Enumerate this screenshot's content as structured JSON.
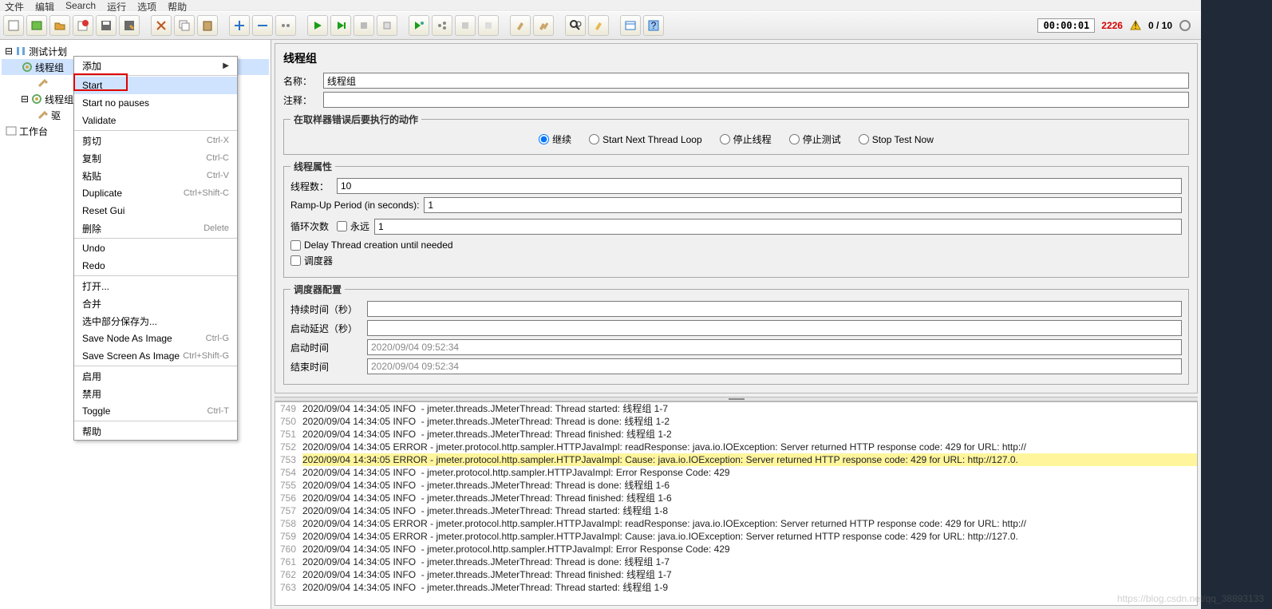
{
  "menubar": [
    "文件",
    "编辑",
    "Search",
    "运行",
    "选项",
    "帮助"
  ],
  "toolbar": {
    "timer": "00:00:01",
    "warn_count": "2226",
    "active": "0 / 10"
  },
  "tree": {
    "root": "测试计划",
    "items": [
      "线程组",
      "线程组",
      "驱"
    ],
    "workbench": "工作台"
  },
  "context_menu": {
    "add": "添加",
    "start": "Start",
    "start_np": "Start no pauses",
    "validate": "Validate",
    "cut": "剪切",
    "cut_sc": "Ctrl-X",
    "copy": "复制",
    "copy_sc": "Ctrl-C",
    "paste": "粘贴",
    "paste_sc": "Ctrl-V",
    "dup": "Duplicate",
    "dup_sc": "Ctrl+Shift-C",
    "reset": "Reset Gui",
    "del": "删除",
    "del_sc": "Delete",
    "undo": "Undo",
    "redo": "Redo",
    "open": "打开...",
    "merge": "合并",
    "save_sel": "选中部分保存为...",
    "save_img": "Save Node As Image",
    "save_img_sc": "Ctrl-G",
    "save_scr": "Save Screen As Image",
    "save_scr_sc": "Ctrl+Shift-G",
    "enable": "启用",
    "disable": "禁用",
    "toggle": "Toggle",
    "toggle_sc": "Ctrl-T",
    "help": "帮助"
  },
  "panel": {
    "title": "线程组",
    "name_label": "名称：",
    "name_value": "线程组",
    "comment_label": "注释：",
    "comment_value": "",
    "error_legend": "在取样器错误后要执行的动作",
    "r1": "继续",
    "r2": "Start Next Thread Loop",
    "r3": "停止线程",
    "r4": "停止测试",
    "r5": "Stop Test Now",
    "props_legend": "线程属性",
    "threads_label": "线程数：",
    "threads_value": "10",
    "ramp_label": "Ramp-Up Period (in seconds):",
    "ramp_value": "1",
    "loop_label": "循环次数",
    "forever_label": "永远",
    "loop_value": "1",
    "delay_cb": "Delay Thread creation until needed",
    "sched_cb": "调度器",
    "sched_legend": "调度器配置",
    "dur_label": "持续时间（秒）",
    "dur_value": "",
    "delay_label": "启动延迟（秒）",
    "delay_value": "",
    "start_label": "启动时间",
    "start_value": "2020/09/04 09:52:34",
    "end_label": "结束时间",
    "end_value": "2020/09/04 09:52:34"
  },
  "log": [
    {
      "n": 749,
      "t": "2020/09/04 14:34:05 INFO  - jmeter.threads.JMeterThread: Thread started: 线程组 1-7"
    },
    {
      "n": 750,
      "t": "2020/09/04 14:34:05 INFO  - jmeter.threads.JMeterThread: Thread is done: 线程组 1-2"
    },
    {
      "n": 751,
      "t": "2020/09/04 14:34:05 INFO  - jmeter.threads.JMeterThread: Thread finished: 线程组 1-2"
    },
    {
      "n": 752,
      "t": "2020/09/04 14:34:05 ERROR - jmeter.protocol.http.sampler.HTTPJavaImpl: readResponse: java.io.IOException: Server returned HTTP response code: 429 for URL: http://"
    },
    {
      "n": 753,
      "t": "2020/09/04 14:34:05 ERROR - jmeter.protocol.http.sampler.HTTPJavaImpl: Cause: java.io.IOException: Server returned HTTP response code: 429 for URL: http://127.0.",
      "hl": true
    },
    {
      "n": 754,
      "t": "2020/09/04 14:34:05 INFO  - jmeter.protocol.http.sampler.HTTPJavaImpl: Error Response Code: 429"
    },
    {
      "n": 755,
      "t": "2020/09/04 14:34:05 INFO  - jmeter.threads.JMeterThread: Thread is done: 线程组 1-6"
    },
    {
      "n": 756,
      "t": "2020/09/04 14:34:05 INFO  - jmeter.threads.JMeterThread: Thread finished: 线程组 1-6"
    },
    {
      "n": 757,
      "t": "2020/09/04 14:34:05 INFO  - jmeter.threads.JMeterThread: Thread started: 线程组 1-8"
    },
    {
      "n": 758,
      "t": "2020/09/04 14:34:05 ERROR - jmeter.protocol.http.sampler.HTTPJavaImpl: readResponse: java.io.IOException: Server returned HTTP response code: 429 for URL: http://"
    },
    {
      "n": 759,
      "t": "2020/09/04 14:34:05 ERROR - jmeter.protocol.http.sampler.HTTPJavaImpl: Cause: java.io.IOException: Server returned HTTP response code: 429 for URL: http://127.0."
    },
    {
      "n": 760,
      "t": "2020/09/04 14:34:05 INFO  - jmeter.protocol.http.sampler.HTTPJavaImpl: Error Response Code: 429"
    },
    {
      "n": 761,
      "t": "2020/09/04 14:34:05 INFO  - jmeter.threads.JMeterThread: Thread is done: 线程组 1-7"
    },
    {
      "n": 762,
      "t": "2020/09/04 14:34:05 INFO  - jmeter.threads.JMeterThread: Thread finished: 线程组 1-7"
    },
    {
      "n": 763,
      "t": "2020/09/04 14:34:05 INFO  - jmeter.threads.JMeterThread: Thread started: 线程组 1-9"
    }
  ],
  "watermark": "https://blog.csdn.net/qq_38893133"
}
